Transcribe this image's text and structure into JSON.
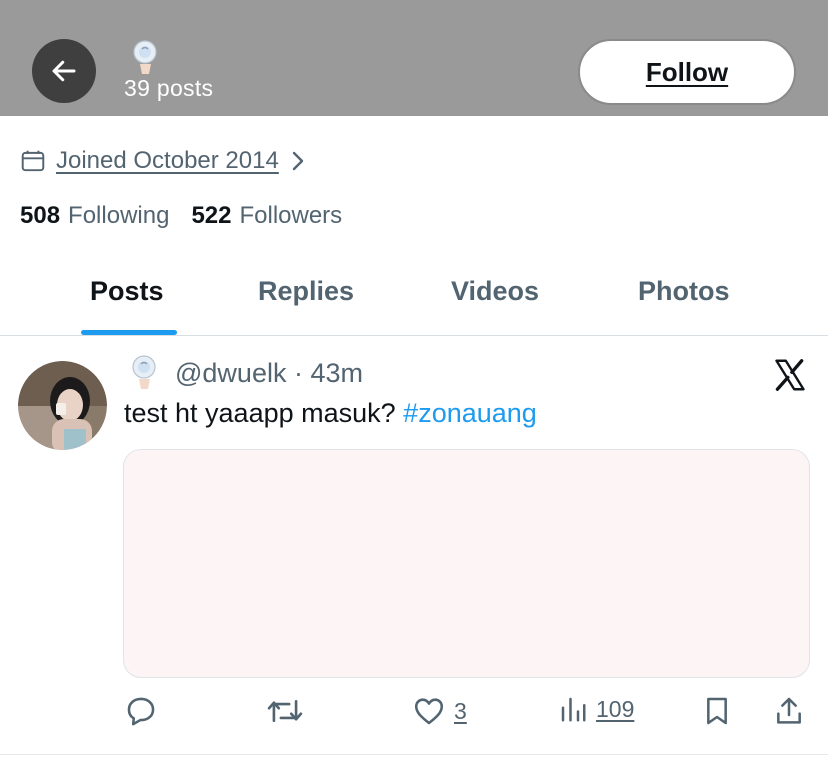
{
  "header": {
    "post_count": "39 posts",
    "follow_label": "Follow"
  },
  "profile": {
    "joined": "Joined October 2014",
    "following_count": "508",
    "following_label": "Following",
    "followers_count": "522",
    "followers_label": "Followers"
  },
  "tabs": [
    {
      "label": "Posts",
      "active": true
    },
    {
      "label": "Replies",
      "active": false
    },
    {
      "label": "Videos",
      "active": false
    },
    {
      "label": "Photos",
      "active": false
    }
  ],
  "post": {
    "handle": "@dwuelk",
    "separator": "·",
    "time": "43m",
    "text": "test ht yaaapp masuk? ",
    "hashtag": "#zonauang",
    "actions": {
      "reply_icon": "reply-icon",
      "repost_icon": "repost-icon",
      "like_count": "3",
      "views_count": "109",
      "bookmark_icon": "bookmark-icon",
      "share_icon": "share-icon"
    }
  },
  "colors": {
    "accent": "#1d9bf0",
    "secondary_text": "#536471",
    "header_bg": "#9a9a9a",
    "media_bg": "#fdf4f5"
  }
}
